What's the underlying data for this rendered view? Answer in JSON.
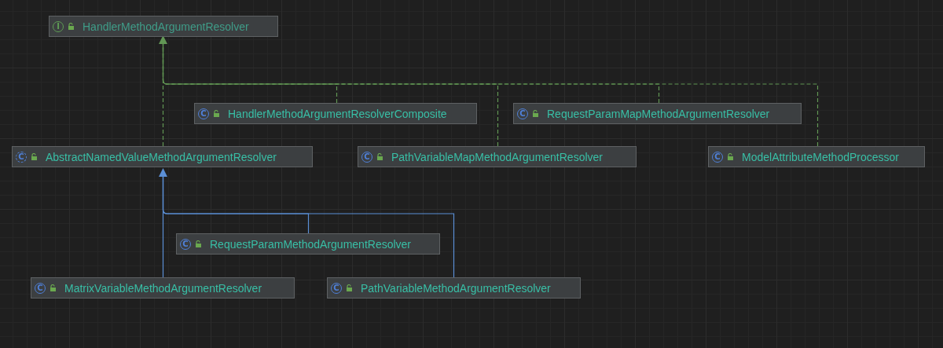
{
  "diagram": {
    "root": {
      "name": "HandlerMethodArgumentResolver",
      "kind": "interface",
      "badge": "I",
      "children": [
        {
          "name": "AbstractNamedValueMethodArgumentResolver",
          "kind": "abstract",
          "badge": "C",
          "children": [
            {
              "name": "RequestParamMethodArgumentResolver",
              "kind": "class",
              "badge": "C"
            },
            {
              "name": "MatrixVariableMethodArgumentResolver",
              "kind": "class",
              "badge": "C"
            },
            {
              "name": "PathVariableMethodArgumentResolver",
              "kind": "class",
              "badge": "C"
            }
          ]
        },
        {
          "name": "HandlerMethodArgumentResolverComposite",
          "kind": "class",
          "badge": "C"
        },
        {
          "name": "PathVariableMapMethodArgumentResolver",
          "kind": "class",
          "badge": "C"
        },
        {
          "name": "RequestParamMapMethodArgumentResolver",
          "kind": "class",
          "badge": "C"
        },
        {
          "name": "ModelAttributeMethodProcessor",
          "kind": "class",
          "badge": "C"
        }
      ]
    }
  }
}
